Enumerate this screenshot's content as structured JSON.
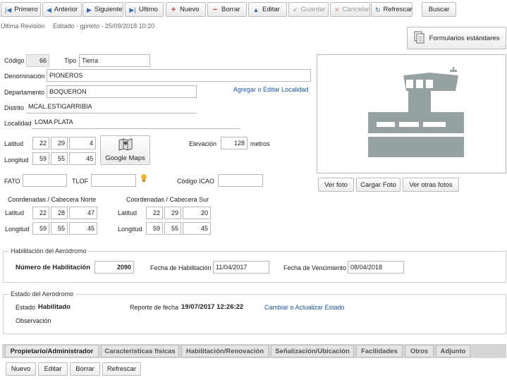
{
  "toolbar": {
    "primero": "Primero",
    "anterior": "Anterior",
    "siguiente": "Siguiente",
    "ultimo": "Ultimo",
    "nuevo": "Nuevo",
    "borrar": "Borrar",
    "editar": "Editar",
    "guardar": "Guardar",
    "cancelar": "Cancelar",
    "refrescar": "Refrescar",
    "buscar": "Buscar"
  },
  "revision": {
    "label": "Última Revisión",
    "value": "Editado - gprieto - 25/09/2018 10:20"
  },
  "formularios_button": "Formularios estándares",
  "form": {
    "codigo_label": "Código",
    "codigo": "66",
    "tipo_label": "Tipo",
    "tipo": "Tierra",
    "denominacion_label": "Denominación",
    "denominacion": "PIONEROS",
    "departamento_label": "Departamento",
    "departamento": "BOQUERON",
    "distrito_label": "Distrito",
    "distrito": "MCAL.ESTIGARRIBIA",
    "localidad_label": "Localidad",
    "localidad": "LOMA PLATA",
    "agregar_localidad_link": "Agregar o Editar Localidad",
    "latitud_label": "Latitud",
    "latitud": [
      "22",
      "29",
      "4"
    ],
    "longitud_label": "Longitud",
    "longitud": [
      "59",
      "55",
      "45"
    ],
    "google_maps_button": "Google Maps",
    "elevacion_label": "Elevación",
    "elevacion": "128",
    "elevacion_unit": "metros",
    "fato_label": "FATO",
    "fato": "",
    "tlof_label": "TLOF",
    "tlof": "",
    "icao_label": "Código ICAO",
    "icao": ""
  },
  "photo_buttons": {
    "ver_foto": "Ver foto",
    "cargar_foto": "Cargar Foto",
    "ver_otras": "Ver otras fotos"
  },
  "coords_norte": {
    "title": "Coordenadas / Cabecera Norte",
    "latitud_label": "Latitud",
    "latitud": [
      "22",
      "28",
      "47"
    ],
    "longitud_label": "Longitud",
    "longitud": [
      "59",
      "55",
      "45"
    ]
  },
  "coords_sur": {
    "title": "Coordenadas / Cabecera Sur",
    "latitud_label": "Latitud",
    "latitud": [
      "22",
      "29",
      "20"
    ],
    "longitud_label": "Longitud",
    "longitud": [
      "59",
      "55",
      "45"
    ]
  },
  "habilitacion": {
    "legend": "Habilitación del Aeródromo",
    "numero_label": "Número de Habilitación",
    "numero": "2090",
    "fecha_hab_label": "Fecha de Habilitación",
    "fecha_hab": "11/04/2017",
    "fecha_venc_label": "Fecha de Vencimiento",
    "fecha_venc": "08/04/2018"
  },
  "estado": {
    "legend": "Estado del Aeródromo",
    "estado_label": "Estado",
    "estado": "Habilitado",
    "reporte_label": "Reporte de fecha",
    "reporte": "19/07/2017 12:26:22",
    "cambiar_link": "Cambiar o Actualizar Estado",
    "observacion_label": "Observación"
  },
  "tabs": [
    "Propietario/Administrador",
    "Caracteristicas fisicas",
    "Habilitación/Renovación",
    "Señalización/Ubicación",
    "Facilidades",
    "Otros",
    "Adjunto"
  ],
  "bottom_buttons": {
    "nuevo": "Nuevo",
    "editar": "Editar",
    "borrar": "Borrar",
    "refrescar": "Refrescar"
  },
  "colors": {
    "accent_link": "#1a55b0",
    "airport_icon": "#96a2a2",
    "toolbar_icon_blue": "#2f6db5",
    "toolbar_icon_red": "#d23a2a"
  }
}
